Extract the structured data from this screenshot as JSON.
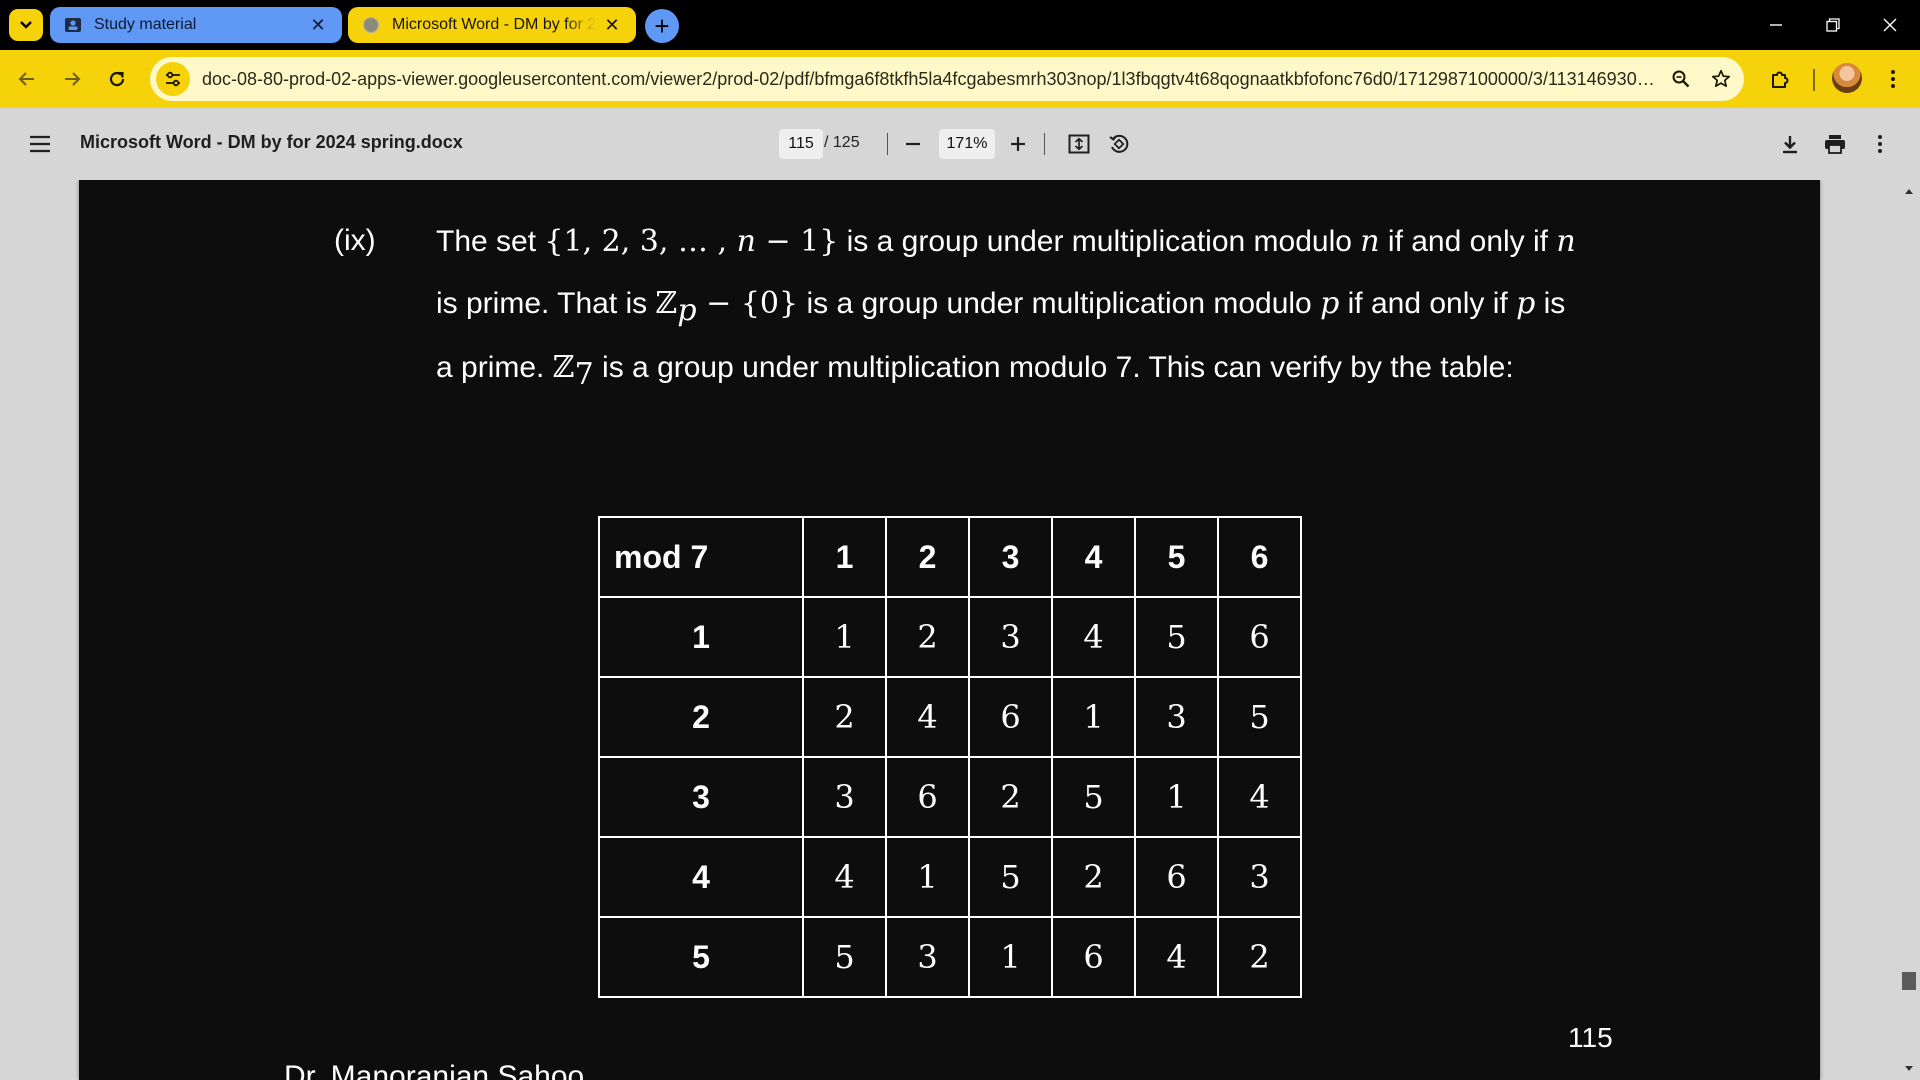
{
  "browser": {
    "tabs": [
      {
        "title": "Study material",
        "close_glyph": "✕"
      },
      {
        "title": "Microsoft Word - DM by for 2024 spring.docx",
        "close_glyph": "✕"
      }
    ],
    "new_tab_glyph": "+",
    "url": "doc-08-80-prod-02-apps-viewer.googleusercontent.com/viewer2/prod-02/pdf/bfmga6f8tkfh5la4fcgabesmrh303nop/1l3fbqgtv4t68qognaatkbfofonc76d0/1712987100000/3/11314693006...",
    "colors": {
      "accent": "#f5d20a",
      "tab_inactive": "#5f98f5",
      "omnibox": "#fff8c9"
    }
  },
  "pdf_toolbar": {
    "title": "Microsoft Word - DM by for 2024 spring.docx",
    "page_current": "115",
    "page_total": "/ 125",
    "zoom": "171%"
  },
  "document": {
    "item_label": "(ix)",
    "line1": {
      "a": "The set ",
      "set": "{1, 2, 3, … , ",
      "n": "n",
      "minus1": " − 1}",
      "b": " is a group under multiplication modulo ",
      "n2": "n",
      "c": " if and only if ",
      "n3": "n"
    },
    "line2": {
      "a": "is prime. That is ",
      "Z": "ℤ",
      "p_sub": "p",
      "minus0": " − {0}",
      "b": " is a group under multiplication modulo ",
      "p": "p",
      "c": " if and only if ",
      "p2": "p",
      "d": " is"
    },
    "line3": {
      "a": "a prime. ",
      "Z": "ℤ",
      "sub7": "7",
      "b": " is a group under multiplication modulo 7. This can verify by the table:"
    },
    "table": {
      "corner": "mod 7",
      "columns": [
        "1",
        "2",
        "3",
        "4",
        "5",
        "6"
      ],
      "rows": [
        {
          "header": "1",
          "cells": [
            "1",
            "2",
            "3",
            "4",
            "5",
            "6"
          ]
        },
        {
          "header": "2",
          "cells": [
            "2",
            "4",
            "6",
            "1",
            "3",
            "5"
          ]
        },
        {
          "header": "3",
          "cells": [
            "3",
            "6",
            "2",
            "5",
            "1",
            "4"
          ]
        },
        {
          "header": "4",
          "cells": [
            "4",
            "1",
            "5",
            "2",
            "6",
            "3"
          ]
        },
        {
          "header": "5",
          "cells": [
            "5",
            "3",
            "1",
            "6",
            "4",
            "2"
          ]
        }
      ]
    },
    "page_number": "115",
    "footer": "Dr. Manoranjan Sahoo"
  }
}
